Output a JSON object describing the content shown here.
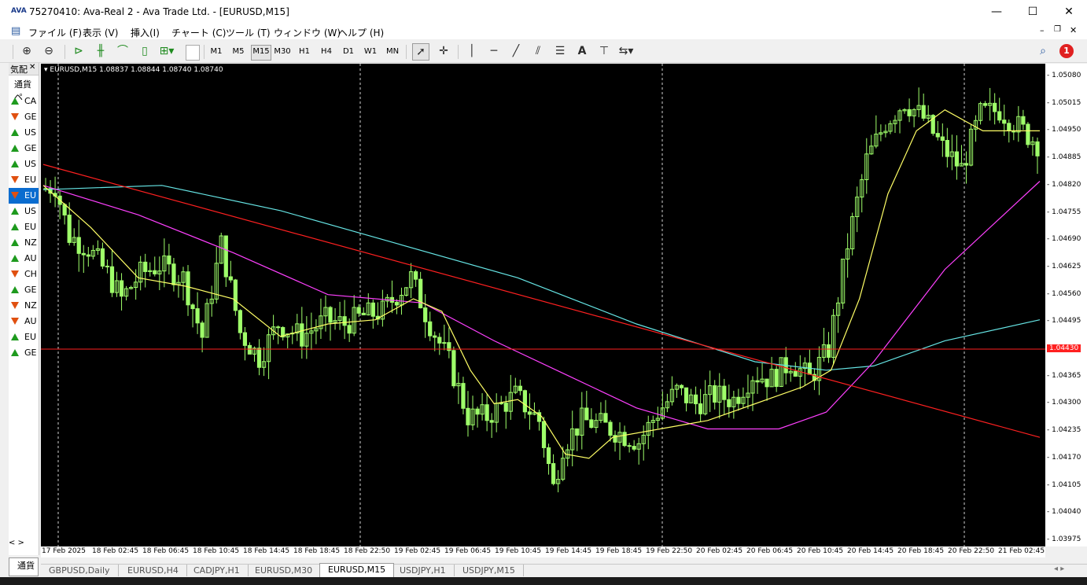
{
  "window": {
    "logo": "AVA",
    "title": "75270410: Ava-Real 2 - Ava Trade Ltd. - [EURUSD,M15]",
    "minimize": "—",
    "maximize": "☐",
    "close": "✕"
  },
  "menu": [
    "ファイル (F)",
    "表示 (V)",
    "挿入(I)",
    "チャート (C)",
    "ツール (T)",
    "ウィンドウ (W)",
    "ヘルプ (H)"
  ],
  "timeframes": [
    "M1",
    "M5",
    "M15",
    "M30",
    "H1",
    "H4",
    "D1",
    "W1",
    "MN"
  ],
  "active_timeframe": "M15",
  "notification_count": "1",
  "market_watch": {
    "title": "気配",
    "close": "✕",
    "header": "通貨ペ",
    "rows": [
      {
        "sym": "CA",
        "dir": "up"
      },
      {
        "sym": "GE",
        "dir": "down"
      },
      {
        "sym": "US",
        "dir": "up"
      },
      {
        "sym": "GE",
        "dir": "up"
      },
      {
        "sym": "US",
        "dir": "up"
      },
      {
        "sym": "EU",
        "dir": "down"
      },
      {
        "sym": "EU",
        "dir": "down",
        "selected": true
      },
      {
        "sym": "US",
        "dir": "up"
      },
      {
        "sym": "EU",
        "dir": "up"
      },
      {
        "sym": "NZ",
        "dir": "up"
      },
      {
        "sym": "AU",
        "dir": "up"
      },
      {
        "sym": "CH",
        "dir": "down"
      },
      {
        "sym": "GE",
        "dir": "up"
      },
      {
        "sym": "NZ",
        "dir": "down"
      },
      {
        "sym": "AU",
        "dir": "down"
      },
      {
        "sym": "EU",
        "dir": "up"
      },
      {
        "sym": "GE",
        "dir": "up"
      }
    ],
    "bottom_tab": "通貨"
  },
  "chart_data": {
    "type": "candlestick",
    "symbol_label": "EURUSD,M15  1.08837 1.08844 1.08740 1.08740",
    "ylim": [
      1.0396,
      1.0511
    ],
    "y_ticks": [
      1.0508,
      1.05015,
      1.0495,
      1.04885,
      1.0482,
      1.04755,
      1.0469,
      1.04625,
      1.0456,
      1.04495,
      1.0443,
      1.04365,
      1.043,
      1.04235,
      1.0417,
      1.04105,
      1.0404,
      1.03975
    ],
    "current_price": "1.04430",
    "x_tick_labels": [
      "17 Feb 2025",
      "18 Feb 02:45",
      "18 Feb 06:45",
      "18 Feb 10:45",
      "18 Feb 14:45",
      "18 Feb 18:45",
      "18 Feb 22:50",
      "19 Feb 02:45",
      "19 Feb 06:45",
      "19 Feb 10:45",
      "19 Feb 14:45",
      "19 Feb 18:45",
      "19 Feb 22:50",
      "20 Feb 02:45",
      "20 Feb 06:45",
      "20 Feb 10:45",
      "20 Feb 14:45",
      "20 Feb 18:45",
      "20 Feb 22:50",
      "21 Feb 02:45"
    ],
    "close_path": [
      [
        0,
        1.0481
      ],
      [
        3,
        1.0482
      ],
      [
        6,
        1.047
      ],
      [
        10,
        1.0467
      ],
      [
        14,
        1.0461
      ],
      [
        17,
        1.0455
      ],
      [
        21,
        1.0461
      ],
      [
        25,
        1.0463
      ],
      [
        30,
        1.046
      ],
      [
        34,
        1.0446
      ],
      [
        38,
        1.0468
      ],
      [
        42,
        1.0447
      ],
      [
        46,
        1.0441
      ],
      [
        50,
        1.0449
      ],
      [
        55,
        1.0446
      ],
      [
        60,
        1.045
      ],
      [
        64,
        1.0449
      ],
      [
        68,
        1.0451
      ],
      [
        72,
        1.0452
      ],
      [
        78,
        1.046
      ],
      [
        82,
        1.0449
      ],
      [
        86,
        1.044
      ],
      [
        90,
        1.0427
      ],
      [
        94,
        1.0427
      ],
      [
        100,
        1.0432
      ],
      [
        105,
        1.0426
      ],
      [
        108,
        1.041
      ],
      [
        110,
        1.042
      ],
      [
        114,
        1.0426
      ],
      [
        118,
        1.0425
      ],
      [
        122,
        1.0423
      ],
      [
        126,
        1.0421
      ],
      [
        130,
        1.0428
      ],
      [
        134,
        1.0433
      ],
      [
        138,
        1.043
      ],
      [
        142,
        1.0432
      ],
      [
        146,
        1.0431
      ],
      [
        150,
        1.0437
      ],
      [
        154,
        1.0436
      ],
      [
        158,
        1.044
      ],
      [
        162,
        1.0436
      ],
      [
        166,
        1.0443
      ],
      [
        170,
        1.0468
      ],
      [
        174,
        1.0488
      ],
      [
        178,
        1.0497
      ],
      [
        182,
        1.0502
      ],
      [
        186,
        1.0498
      ],
      [
        190,
        1.0491
      ],
      [
        194,
        1.0486
      ],
      [
        198,
        1.0499
      ],
      [
        202,
        1.05
      ],
      [
        206,
        1.0496
      ],
      [
        210,
        1.0492
      ]
    ],
    "ma_fast": [
      [
        0,
        1.0482
      ],
      [
        10,
        1.0472
      ],
      [
        20,
        1.046
      ],
      [
        30,
        1.0458
      ],
      [
        40,
        1.0455
      ],
      [
        50,
        1.0446
      ],
      [
        60,
        1.0449
      ],
      [
        70,
        1.045
      ],
      [
        78,
        1.0455
      ],
      [
        84,
        1.0452
      ],
      [
        90,
        1.0438
      ],
      [
        95,
        1.043
      ],
      [
        100,
        1.0431
      ],
      [
        105,
        1.0427
      ],
      [
        110,
        1.0418
      ],
      [
        115,
        1.0417
      ],
      [
        120,
        1.0422
      ],
      [
        130,
        1.0424
      ],
      [
        140,
        1.0426
      ],
      [
        150,
        1.043
      ],
      [
        160,
        1.0434
      ],
      [
        166,
        1.0438
      ],
      [
        172,
        1.0455
      ],
      [
        178,
        1.048
      ],
      [
        184,
        1.0495
      ],
      [
        190,
        1.05
      ],
      [
        198,
        1.0495
      ],
      [
        210,
        1.0495
      ]
    ],
    "ma_mid": [
      [
        0,
        1.0482
      ],
      [
        20,
        1.0475
      ],
      [
        40,
        1.0466
      ],
      [
        60,
        1.0456
      ],
      [
        80,
        1.0454
      ],
      [
        95,
        1.0445
      ],
      [
        110,
        1.0437
      ],
      [
        125,
        1.0429
      ],
      [
        140,
        1.0424
      ],
      [
        155,
        1.0424
      ],
      [
        165,
        1.0428
      ],
      [
        175,
        1.044
      ],
      [
        190,
        1.0462
      ],
      [
        210,
        1.0483
      ]
    ],
    "ma_slow": [
      [
        0,
        1.0481
      ],
      [
        25,
        1.0482
      ],
      [
        50,
        1.0476
      ],
      [
        75,
        1.0468
      ],
      [
        100,
        1.046
      ],
      [
        125,
        1.0449
      ],
      [
        150,
        1.044
      ],
      [
        165,
        1.0438
      ],
      [
        175,
        1.0439
      ],
      [
        190,
        1.0445
      ],
      [
        210,
        1.045
      ]
    ],
    "trendline": [
      [
        0,
        1.0487
      ],
      [
        210,
        1.0422
      ]
    ],
    "bar_count": 210
  },
  "tabs": [
    "GBPUSD,Daily",
    "EURUSD,H4",
    "CADJPY,H1",
    "EURUSD,M30",
    "EURUSD,M15",
    "USDJPY,H1",
    "USDJPY,M15"
  ],
  "active_tab": "EURUSD,M15",
  "colors": {
    "candle": "#9fff6a",
    "ma_fast": "#ffff66",
    "ma_mid": "#ff40ff",
    "ma_slow": "#66e5e5",
    "trendline": "#ff2020",
    "bid_line": "#ff2020"
  }
}
